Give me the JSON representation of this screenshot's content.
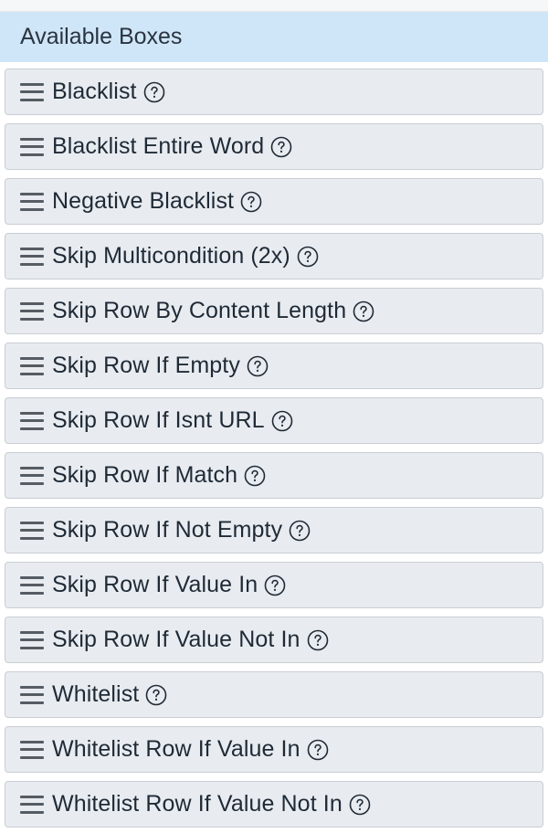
{
  "header": {
    "title": "Available Boxes"
  },
  "boxes": [
    {
      "label": "Blacklist",
      "icon": "help-icon"
    },
    {
      "label": "Blacklist Entire Word",
      "icon": "help-icon"
    },
    {
      "label": "Negative Blacklist",
      "icon": "help-icon"
    },
    {
      "label": "Skip Multicondition (2x)",
      "icon": "help-icon"
    },
    {
      "label": "Skip Row By Content Length",
      "icon": "help-icon"
    },
    {
      "label": "Skip Row If Empty",
      "icon": "help-icon"
    },
    {
      "label": "Skip Row If Isnt URL",
      "icon": "help-icon"
    },
    {
      "label": "Skip Row If Match",
      "icon": "help-icon"
    },
    {
      "label": "Skip Row If Not Empty",
      "icon": "help-icon"
    },
    {
      "label": "Skip Row If Value In",
      "icon": "help-icon"
    },
    {
      "label": "Skip Row If Value Not In",
      "icon": "help-icon"
    },
    {
      "label": "Whitelist",
      "icon": "help-icon"
    },
    {
      "label": "Whitelist Row If Value In",
      "icon": "help-icon"
    },
    {
      "label": "Whitelist Row If Value Not In",
      "icon": "help-icon"
    }
  ],
  "colors": {
    "header_bg": "#cfe6f8",
    "item_bg": "#e8ecf0",
    "item_border": "#c9ced4",
    "text": "#1f2a36"
  }
}
